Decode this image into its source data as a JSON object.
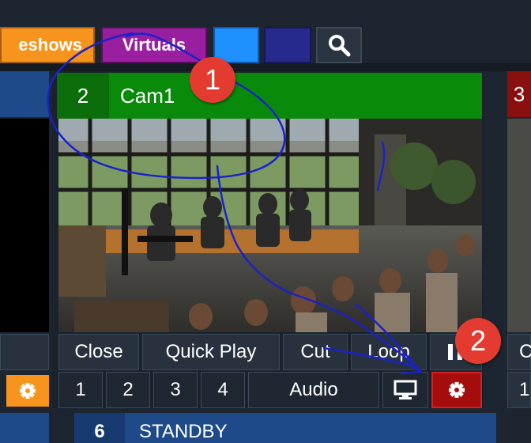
{
  "tabs": {
    "slideshows": "eshows",
    "virtuals": "Virtuals"
  },
  "input": {
    "number": "2",
    "name": "Cam1",
    "controls_row1": {
      "close": "Close",
      "quick_play": "Quick Play",
      "cut": "Cut",
      "loop": "Loop"
    },
    "controls_row2": {
      "layer1": "1",
      "layer2": "2",
      "layer3": "3",
      "layer4": "4",
      "audio": "Audio"
    }
  },
  "right_input": {
    "number": "3",
    "row1_partial": "C",
    "row2_partial": "1"
  },
  "standby": {
    "number": "6",
    "label": "STANDBY"
  },
  "annotations": {
    "badge1": "1",
    "badge2": "2"
  },
  "colors": {
    "slideshows_tab": "#f7941d",
    "virtuals_tab": "#9a1fa0",
    "input_header_green": "#0a8a0a",
    "settings_red": "#a50d0d",
    "settings_orange": "#f7941d",
    "annotation_badge": "#e33b30",
    "annotation_ink": "#1a22c8"
  },
  "icons": {
    "search": "search-icon",
    "pause": "pause-icon",
    "monitor": "monitor-icon",
    "settings": "gear-icon"
  }
}
